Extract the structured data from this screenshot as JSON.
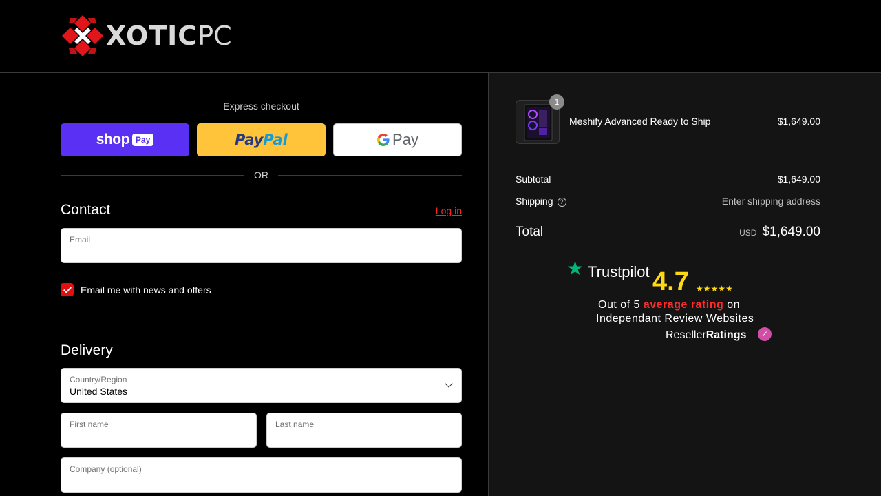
{
  "header": {
    "logo_primary": "XOTIC",
    "logo_secondary": "PC"
  },
  "express": {
    "label": "Express checkout",
    "shoppay_text": "shop",
    "shoppay_pill": "Pay",
    "paypal_part1": "Pay",
    "paypal_part2": "Pal",
    "gpay_g": "G",
    "gpay_text": "Pay",
    "or_text": "OR"
  },
  "contact": {
    "title": "Contact",
    "login_label": "Log in",
    "email_label": "Email",
    "email_value": "",
    "newsletter_label": "Email me with news and offers",
    "newsletter_checked": true
  },
  "delivery": {
    "title": "Delivery",
    "country_label": "Country/Region",
    "country_value": "United States",
    "first_name_label": "First name",
    "last_name_label": "Last name",
    "company_label": "Company (optional)"
  },
  "order": {
    "item_name": "Meshify Advanced Ready to Ship",
    "item_price": "$1,649.00",
    "item_qty": "1",
    "subtotal_label": "Subtotal",
    "subtotal_value": "$1,649.00",
    "shipping_label": "Shipping",
    "shipping_value": "Enter shipping address",
    "total_label": "Total",
    "total_currency": "USD",
    "total_value": "$1,649.00"
  },
  "trust": {
    "star": "★",
    "brand": "Trustpilot",
    "score": "4.7",
    "stars": "★★★★★",
    "line1_pre": "Out of 5",
    "line1_hl": "average rating",
    "line1_post": "on",
    "line2": "Independant Review Websites",
    "rr_prefix": "Reseller",
    "rr_bold": "Ratings"
  },
  "colors": {
    "accent": "#e30f0f",
    "shoppay": "#5a31f4",
    "paypal": "#ffc439",
    "trustpilot_green": "#00b67a",
    "score_yellow": "#ffd814"
  }
}
